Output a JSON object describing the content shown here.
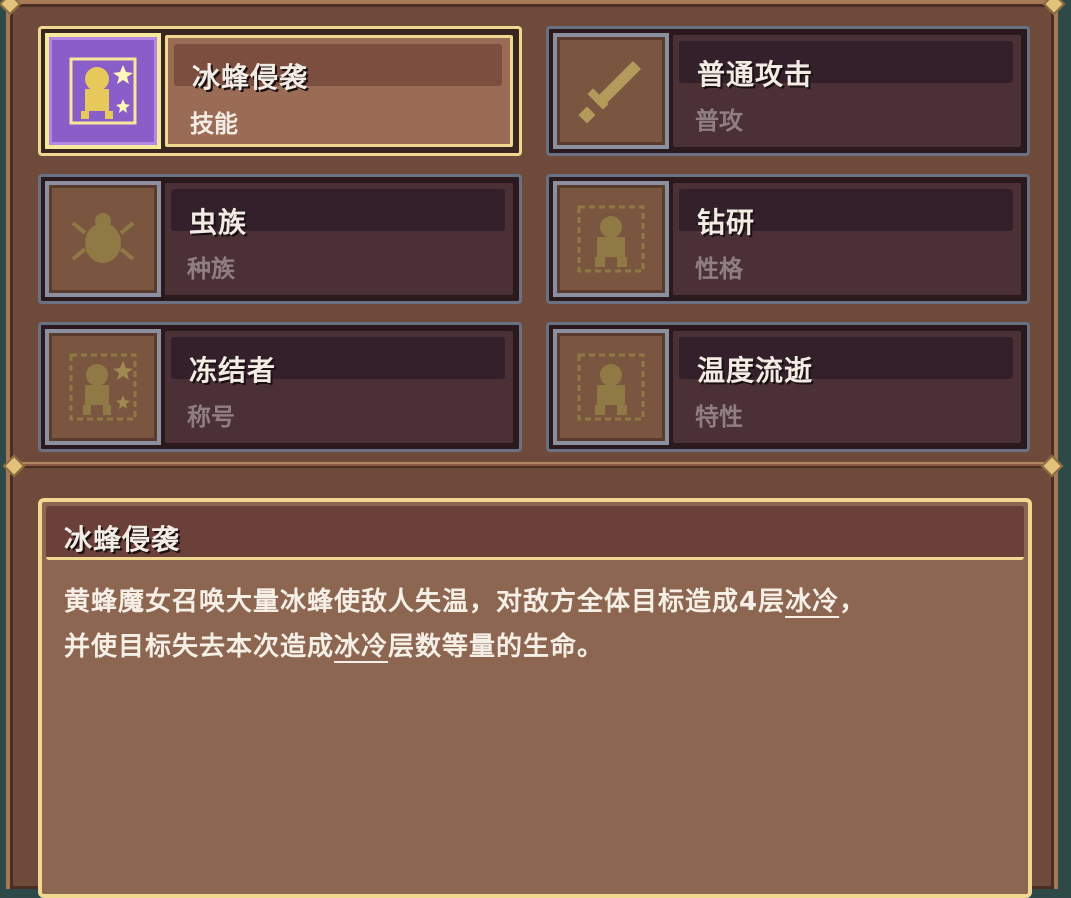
{
  "cards": [
    {
      "name": "冰蜂侵袭",
      "type": "技能",
      "icon": "ice-bee-skill-icon",
      "selected": true
    },
    {
      "name": "普通攻击",
      "type": "普攻",
      "icon": "sword-icon",
      "selected": false
    },
    {
      "name": "虫族",
      "type": "种族",
      "icon": "beetle-icon",
      "selected": false
    },
    {
      "name": "钻研",
      "type": "性格",
      "icon": "figure-icon",
      "selected": false
    },
    {
      "name": "冻结者",
      "type": "称号",
      "icon": "ice-figure-icon",
      "selected": false
    },
    {
      "name": "温度流逝",
      "type": "特性",
      "icon": "figure-icon",
      "selected": false
    }
  ],
  "description": {
    "title": "冰蜂侵袭",
    "line1_pre": "黄蜂魔女召唤大量冰蜂使敌人失温，对敌方全体目标造成4层",
    "line1_kw": "冰冷",
    "line1_post": "，",
    "line2_pre": "并使目标失去本次造成",
    "line2_kw": "冰冷",
    "line2_post": "层数等量的生命。"
  },
  "colors": {
    "panel_bg": "#6e4a3b",
    "selected_border": "#f0d890",
    "selected_icon_bg": "#8a5ec8",
    "card_border": "#6a7182"
  }
}
